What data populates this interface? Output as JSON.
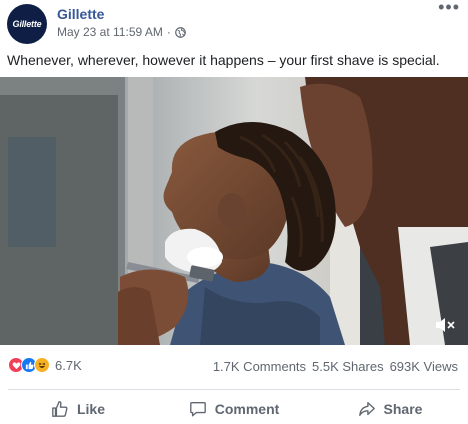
{
  "post": {
    "page_name": "Gillette",
    "avatar_text": "Gillette",
    "date": "May 23 at 11:59 AM",
    "separator": "·",
    "privacy_icon": "globe-icon",
    "more_label": "•••",
    "caption": "Whenever, wherever, however it happens – your first shave is special."
  },
  "video": {
    "mute_icon": "speaker-muted-icon"
  },
  "stats": {
    "reactions": [
      "love-reaction-icon",
      "like-reaction-icon",
      "haha-reaction-icon"
    ],
    "reaction_count": "6.7K",
    "comments": "1.7K Comments",
    "shares": "5.5K Shares",
    "views": "693K Views"
  },
  "actions": {
    "like": "Like",
    "comment": "Comment",
    "share": "Share"
  },
  "colors": {
    "brand_link": "#365899",
    "love": "#f33e58",
    "like": "#1877f2",
    "haha": "#f7b125",
    "muted_text": "#606770"
  }
}
